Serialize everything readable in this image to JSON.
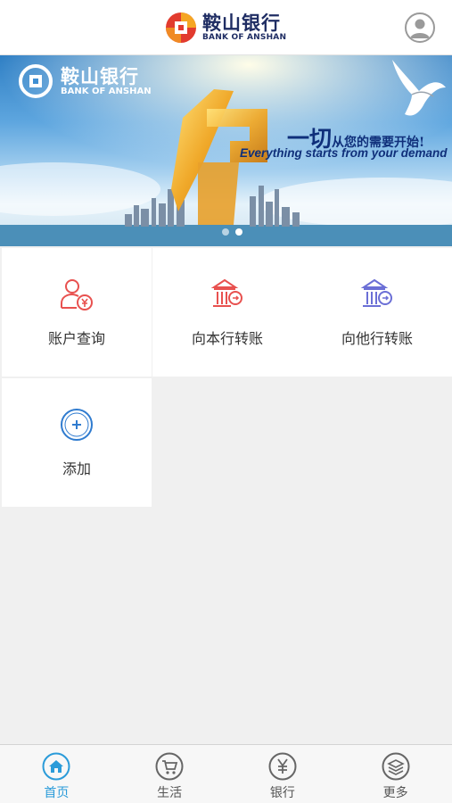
{
  "header": {
    "brand_cn": "鞍山银行",
    "brand_en": "BANK OF ANSHAN",
    "profile_icon": "user-avatar-icon"
  },
  "banner": {
    "brand_cn": "鞍山银行",
    "brand_en": "BANK OF ANSHAN",
    "slogan_cn_big": "一切",
    "slogan_cn_rest": "从您的需要开始!",
    "slogan_en": "Everything starts from your demand",
    "slide_count": 2,
    "active_slide": 2
  },
  "tiles": [
    {
      "label": "账户查询",
      "icon": "account-query-icon"
    },
    {
      "label": "向本行转账",
      "icon": "bank-transfer-icon"
    },
    {
      "label": "向他行转账",
      "icon": "interbank-transfer-icon"
    },
    {
      "label": "添加",
      "icon": "add-circle-icon"
    }
  ],
  "tabbar": [
    {
      "label": "首页",
      "icon": "home-icon",
      "active": true
    },
    {
      "label": "生活",
      "icon": "cart-icon",
      "active": false
    },
    {
      "label": "银行",
      "icon": "yen-icon",
      "active": false
    },
    {
      "label": "更多",
      "icon": "layers-icon",
      "active": false
    }
  ],
  "colors": {
    "brand_navy": "#1f2d63",
    "accent_blue": "#2a9bd9",
    "tile_red": "#e8514f",
    "tile_purple": "#6b6fd6",
    "add_blue": "#2f7bcf"
  }
}
